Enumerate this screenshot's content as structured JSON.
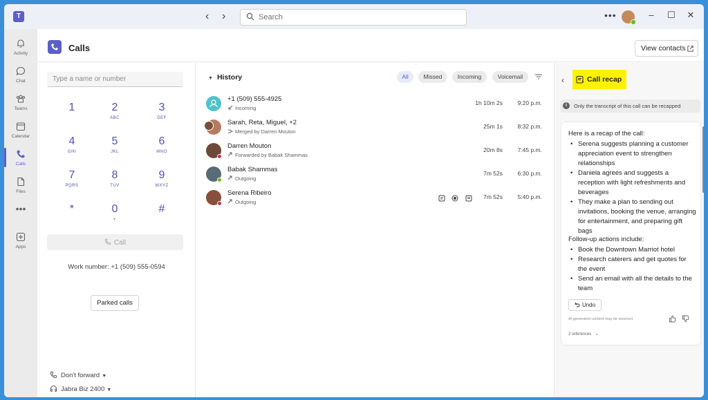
{
  "titlebar": {
    "logo_text": "T",
    "search_placeholder": "Search",
    "more_label": "•••"
  },
  "rail": {
    "items": [
      {
        "label": "Activity",
        "icon": "bell-icon"
      },
      {
        "label": "Chat",
        "icon": "chat-icon"
      },
      {
        "label": "Teams",
        "icon": "teams-icon"
      },
      {
        "label": "Calendar",
        "icon": "calendar-icon"
      },
      {
        "label": "Calls",
        "icon": "phone-icon",
        "active": true
      },
      {
        "label": "Files",
        "icon": "file-icon"
      },
      {
        "label": "Apps",
        "icon": "apps-icon"
      }
    ],
    "more_label": "•••"
  },
  "header": {
    "title": "Calls",
    "view_contacts": "View contacts"
  },
  "dialpad": {
    "input_placeholder": "Type a name or number",
    "keys": [
      {
        "digit": "1",
        "letters": ""
      },
      {
        "digit": "2",
        "letters": "ABC"
      },
      {
        "digit": "3",
        "letters": "DEF"
      },
      {
        "digit": "4",
        "letters": "GHI"
      },
      {
        "digit": "5",
        "letters": "JKL"
      },
      {
        "digit": "6",
        "letters": "MNO"
      },
      {
        "digit": "7",
        "letters": "PQRS"
      },
      {
        "digit": "8",
        "letters": "TUV"
      },
      {
        "digit": "9",
        "letters": "WXYZ"
      },
      {
        "digit": "*",
        "letters": ""
      },
      {
        "digit": "0",
        "letters": "+"
      },
      {
        "digit": "#",
        "letters": ""
      }
    ],
    "call_label": "Call",
    "work_number": "Work number: +1 (509) 555-0594",
    "parked_calls": "Parked calls",
    "forward_label": "Don't forward",
    "device_label": "Jabra Biz 2400"
  },
  "history": {
    "title": "History",
    "filters": [
      "All",
      "Missed",
      "Incoming",
      "Voicemail"
    ],
    "active_filter": "All",
    "rows": [
      {
        "name": "+1 (509) 555-4925",
        "sub": "Incoming",
        "duration": "1h 10m 2s",
        "time": "9:20 p.m.",
        "avatar_color": "#4fc3c9",
        "status_color": ""
      },
      {
        "name": "Sarah, Reta, Miguel, +2",
        "sub": "Merged by Darren Mouton",
        "duration": "25m 1s",
        "time": "8:32 p.m.",
        "avatar_color": "#b87a5e",
        "status_color": ""
      },
      {
        "name": "Darren Mouton",
        "sub": "Forwarded by Babak Shammas",
        "duration": "20m 8s",
        "time": "7:45 p.m.",
        "avatar_color": "#6b4a3a",
        "status_color": "#c4314b"
      },
      {
        "name": "Babak Shammas",
        "sub": "Outgoing",
        "duration": "7m 52s",
        "time": "6:30 p.m.",
        "avatar_color": "#5a6b78",
        "status_color": "#6bb700"
      },
      {
        "name": "Serena Ribeiro",
        "sub": "Outgoing",
        "duration": "7m 52s",
        "time": "5:40 p.m.",
        "avatar_color": "#8a4e3c",
        "status_color": "#c4314b"
      }
    ]
  },
  "recap": {
    "title": "Call recap",
    "notice": "Only the transcript of this call can be recapped",
    "intro": "Here is a recap of the call:",
    "bullets": [
      "Serena suggests planning a customer appreciation event to strengthen relationships",
      "Daniela agrees and suggests a reception with light refreshments and beverages",
      "They make a plan to sending out invitations, booking the venue, arranging for entertainment, and preparing gift bags"
    ],
    "followup_title": "Follow-up actions include:",
    "followups": [
      "Book the Downtown Marriot hotel",
      "Research caterers and get quotes for the event",
      "Send an email with all the details to the team"
    ],
    "undo": "Undo",
    "disclaimer": "AI-generated content may be incorrect",
    "references": "2 references"
  },
  "colors": {
    "brand": "#5b5fc7",
    "highlight": "#fff200",
    "frame": "#3a8fd9"
  }
}
